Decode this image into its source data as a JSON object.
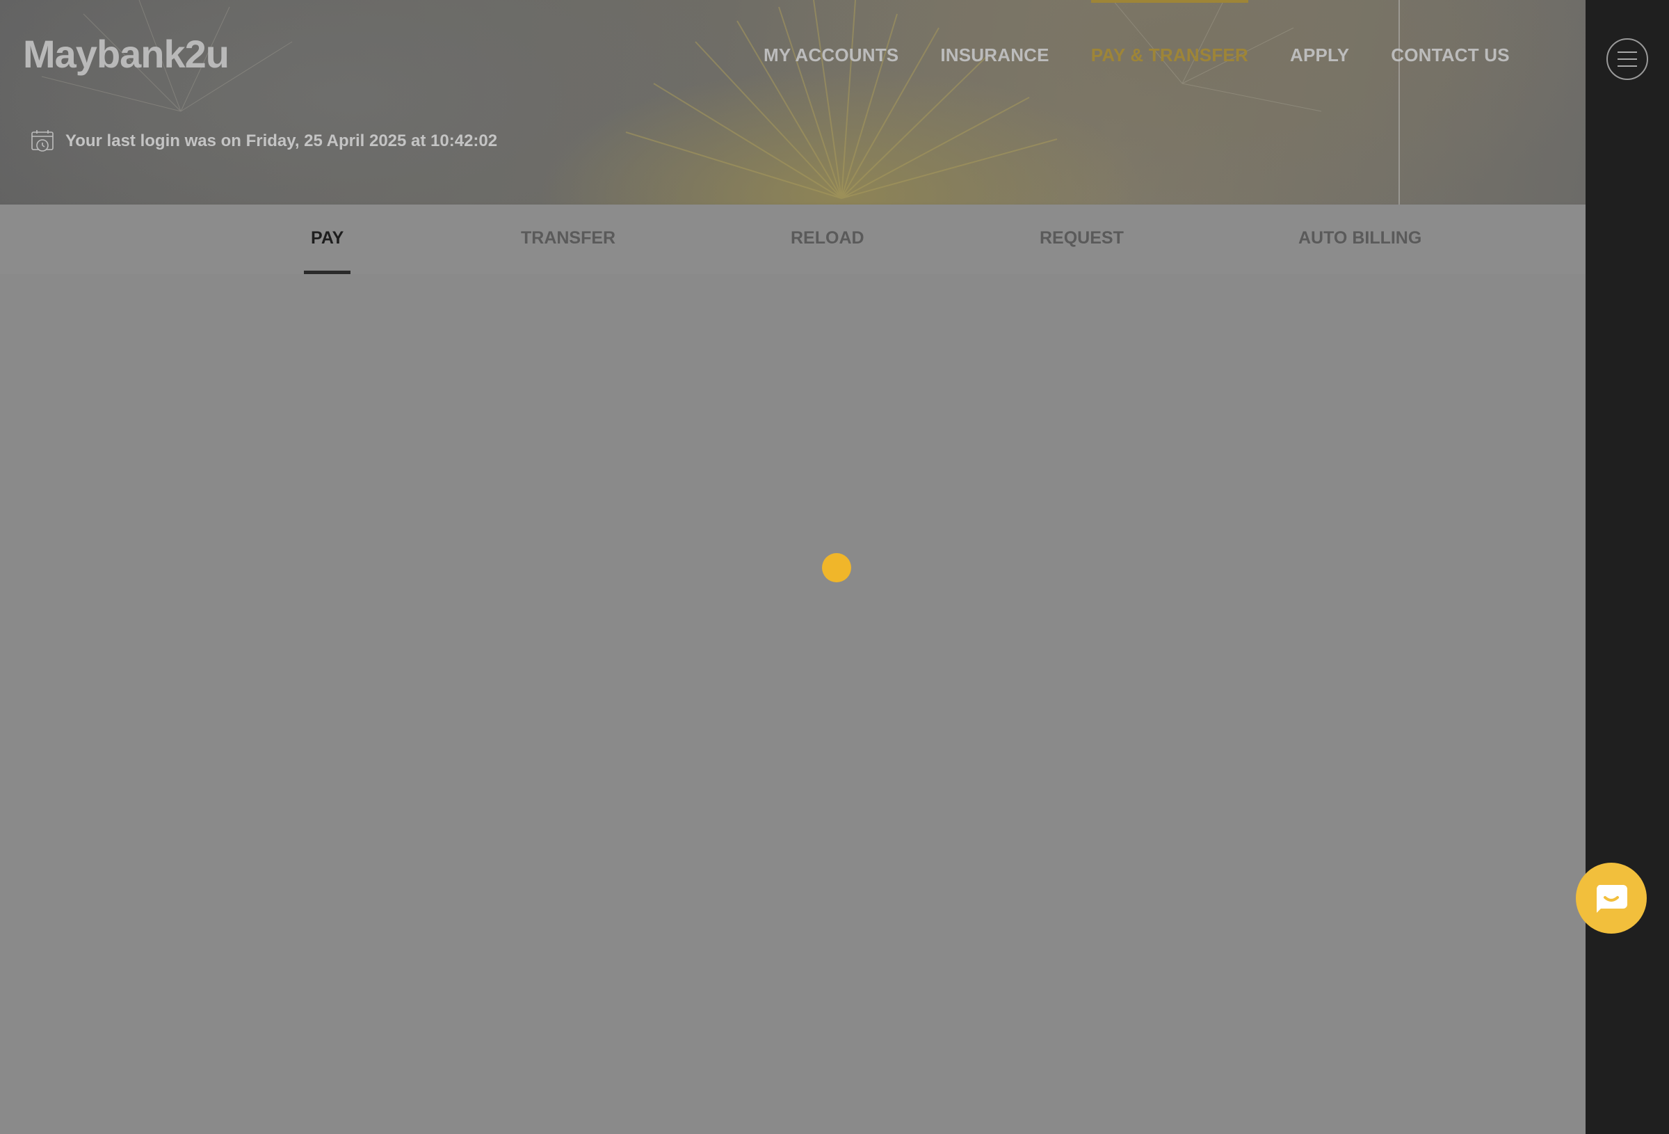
{
  "brand": {
    "logo_text": "Maybank2u"
  },
  "topnav": {
    "items": [
      {
        "label": "MY ACCOUNTS"
      },
      {
        "label": "INSURANCE"
      },
      {
        "label": "PAY & TRANSFER",
        "active": true
      },
      {
        "label": "APPLY"
      },
      {
        "label": "CONTACT US"
      }
    ]
  },
  "last_login": {
    "text": "Your last login was on Friday, 25 April 2025 at 10:42:02",
    "icon": "calendar-clock-icon"
  },
  "subtabs": {
    "items": [
      {
        "label": "PAY",
        "active": true
      },
      {
        "label": "TRANSFER"
      },
      {
        "label": "RELOAD"
      },
      {
        "label": "REQUEST"
      },
      {
        "label": "AUTO BILLING"
      }
    ]
  },
  "sidebar": {
    "menu_icon": "hamburger-menu-icon"
  },
  "chat": {
    "icon": "chat-bubble-icon"
  },
  "colors": {
    "accent": "#9e8537",
    "loader": "#f0b62a",
    "chat_button": "#f2bf3c",
    "sidebar": "#1f1f1f",
    "overlay": "#8a8a8a"
  }
}
